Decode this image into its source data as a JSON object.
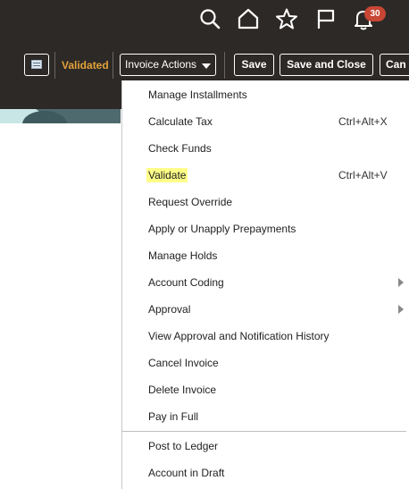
{
  "toolbar": {
    "status": "Validated",
    "invoice_actions_label": "Invoice Actions",
    "save_label": "Save",
    "save_and_close_label": "Save and Close",
    "cancel_label": "Can",
    "notification_count": "30"
  },
  "menu": {
    "items": [
      {
        "label": "Manage Installments"
      },
      {
        "label": "Calculate Tax",
        "shortcut": "Ctrl+Alt+X"
      },
      {
        "label": "Check Funds"
      },
      {
        "label": "Validate",
        "shortcut": "Ctrl+Alt+V",
        "highlighted": true
      },
      {
        "label": "Request Override"
      },
      {
        "label": "Apply or Unapply Prepayments"
      },
      {
        "label": "Manage Holds"
      },
      {
        "label": "Account Coding",
        "submenu": true
      },
      {
        "label": "Approval",
        "submenu": true
      },
      {
        "label": "View Approval and Notification History"
      },
      {
        "label": "Cancel Invoice"
      },
      {
        "label": "Delete Invoice"
      },
      {
        "label": "Pay in Full"
      },
      {
        "label": "Post to Ledger"
      },
      {
        "label": "Account in Draft"
      }
    ]
  },
  "colors": {
    "header_bg": "#2d2926",
    "status": "#e2a33b",
    "highlight": "#ffff88",
    "badge": "#c74634"
  },
  "icons": [
    "search-icon",
    "home-icon",
    "star-icon",
    "flag-icon",
    "bell-icon",
    "list-icon",
    "caret-down-icon",
    "chevron-right-icon"
  ]
}
